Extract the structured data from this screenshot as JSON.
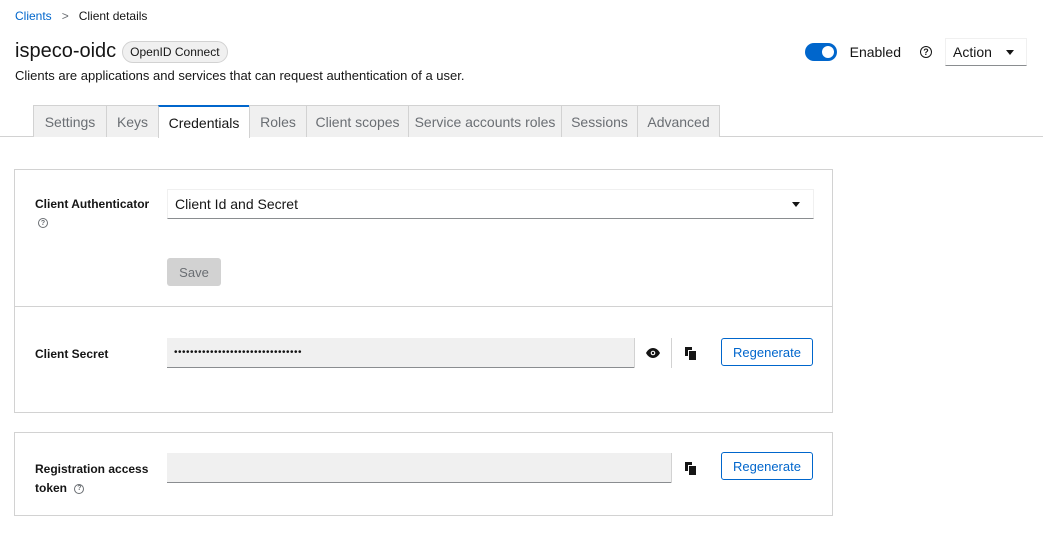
{
  "breadcrumb": {
    "parent": "Clients",
    "separator": ">",
    "current": "Client details"
  },
  "header": {
    "title": "ispeco-oidc",
    "badge": "OpenID Connect",
    "subtitle": "Clients are applications and services that can request authentication of a user.",
    "enabled_label": "Enabled",
    "enabled": true,
    "help_glyph": "?",
    "action_label": "Action"
  },
  "tabs": [
    {
      "label": "Settings"
    },
    {
      "label": "Keys"
    },
    {
      "label": "Credentials",
      "active": true
    },
    {
      "label": "Roles"
    },
    {
      "label": "Client scopes"
    },
    {
      "label": "Service accounts roles"
    },
    {
      "label": "Sessions"
    },
    {
      "label": "Advanced"
    }
  ],
  "credentials": {
    "authenticator_label": "Client Authenticator",
    "authenticator_value": "Client Id and Secret",
    "save_label": "Save",
    "secret_label": "Client Secret",
    "secret_value": "••••••••••••••••••••••••••••••••",
    "regenerate_label": "Regenerate",
    "registration_label_line1": "Registration access",
    "registration_label_line2": "token",
    "registration_value": "",
    "help_glyph": "?"
  },
  "colors": {
    "accent": "#0066cc",
    "border": "#d2d2d2",
    "muted_bg": "#f0f0f0"
  },
  "icons": {
    "eye": "eye-icon",
    "copy": "copy-icon",
    "help": "help-icon",
    "caret": "caret-down-icon"
  }
}
